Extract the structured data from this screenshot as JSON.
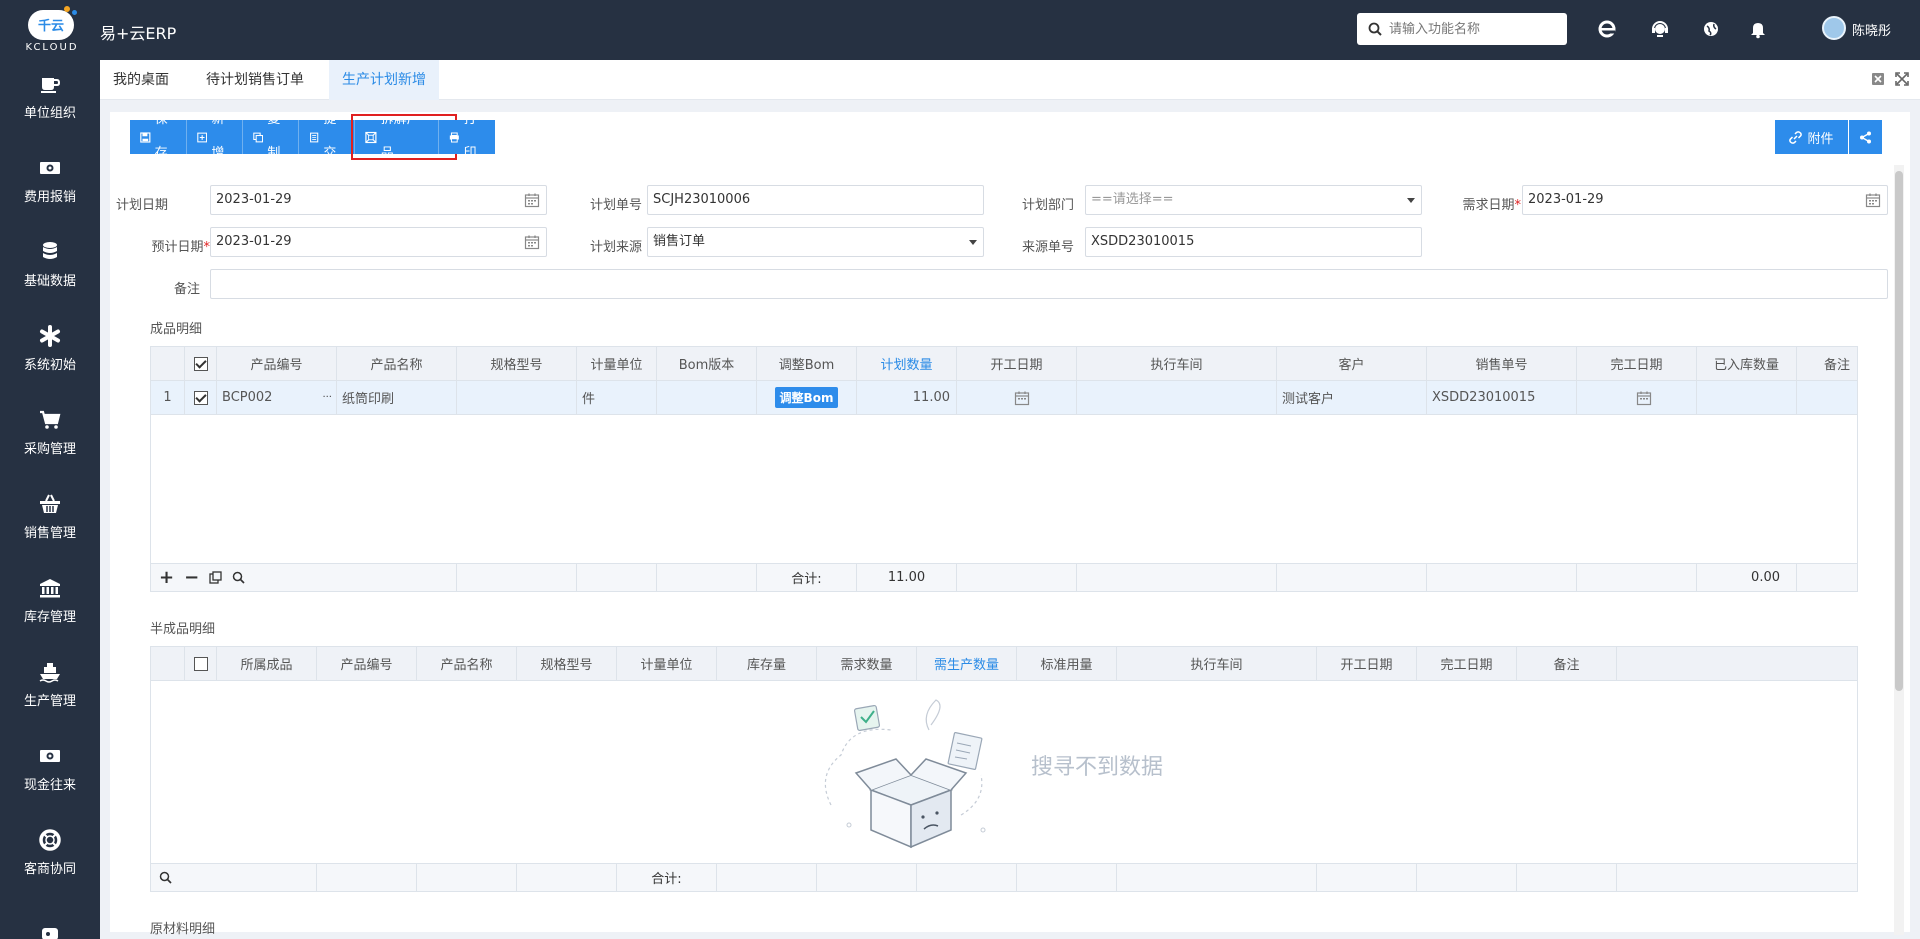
{
  "app": {
    "logo_text": "千云",
    "logo_sub": "KCLOUD",
    "title": "易+云ERP"
  },
  "header": {
    "search_placeholder": "请输入功能名称",
    "icons": [
      "ie-icon",
      "support-icon",
      "globe-icon",
      "bell-icon"
    ],
    "username": "陈晓彤"
  },
  "sidebar": {
    "items": [
      {
        "label": "单位组织",
        "icon": "cup-icon"
      },
      {
        "label": "费用报销",
        "icon": "money-icon"
      },
      {
        "label": "基础数据",
        "icon": "database-icon"
      },
      {
        "label": "系统初始",
        "icon": "asterisk-icon"
      },
      {
        "label": "采购管理",
        "icon": "cart-icon"
      },
      {
        "label": "销售管理",
        "icon": "basket-icon"
      },
      {
        "label": "库存管理",
        "icon": "bank-icon"
      },
      {
        "label": "生产管理",
        "icon": "ship-icon"
      },
      {
        "label": "现金往来",
        "icon": "money-icon"
      },
      {
        "label": "客商协同",
        "icon": "lifebuoy-icon"
      }
    ]
  },
  "tabs": [
    {
      "label": "我的桌面"
    },
    {
      "label": "待计划销售订单"
    },
    {
      "label": "生产计划新增"
    }
  ],
  "toolbar": {
    "save": "保存",
    "add": "新增",
    "copy": "复制",
    "submit": "提交",
    "split": "拆解产品",
    "print": "打印",
    "attach": "附件"
  },
  "form": {
    "plan_date_label": "计划日期",
    "plan_date": "2023-01-29",
    "plan_no_label": "计划单号",
    "plan_no": "SCJH23010006",
    "plan_dept_label": "计划部门",
    "plan_dept_placeholder": "==请选择==",
    "need_date_label": "需求日期",
    "need_date": "2023-01-29",
    "est_date_label": "预计日期",
    "est_date": "2023-01-29",
    "plan_source_label": "计划来源",
    "plan_source": "销售订单",
    "source_no_label": "来源单号",
    "source_no": "XSDD23010015",
    "remark_label": "备注",
    "remark": "",
    "required_mark": "*"
  },
  "finished": {
    "title": "成品明细",
    "headers": [
      "产品编号",
      "产品名称",
      "规格型号",
      "计量单位",
      "Bom版本",
      "调整Bom",
      "计划数量",
      "开工日期",
      "执行车间",
      "客户",
      "销售单号",
      "完工日期",
      "已入库数量",
      "备注"
    ],
    "rows": [
      {
        "no": "1",
        "code": "BCP002",
        "ellipsis": "···",
        "name": "纸筒印刷",
        "spec": "",
        "unit": "件",
        "bom": "",
        "adjust": "调整Bom",
        "qty": "11.00",
        "start": "",
        "workshop": "",
        "customer": "测试客户",
        "sales_no": "XSDD23010015",
        "finish": "",
        "stocked": "",
        "note": ""
      }
    ],
    "footer": {
      "total_label": "合计:",
      "qty_total": "11.00",
      "stocked_total": "0.00"
    }
  },
  "semi": {
    "title": "半成品明细",
    "headers": [
      "所属成品",
      "产品编号",
      "产品名称",
      "规格型号",
      "计量单位",
      "库存量",
      "需求数量",
      "需生产数量",
      "标准用量",
      "执行车间",
      "开工日期",
      "完工日期",
      "备注"
    ],
    "empty": "搜寻不到数据",
    "footer": {
      "total_label": "合计:"
    }
  },
  "raw": {
    "title": "原材料明细"
  },
  "colors": {
    "accent": "#2d8ceb",
    "nav_bg": "#263142",
    "highlight": "#e02020"
  }
}
